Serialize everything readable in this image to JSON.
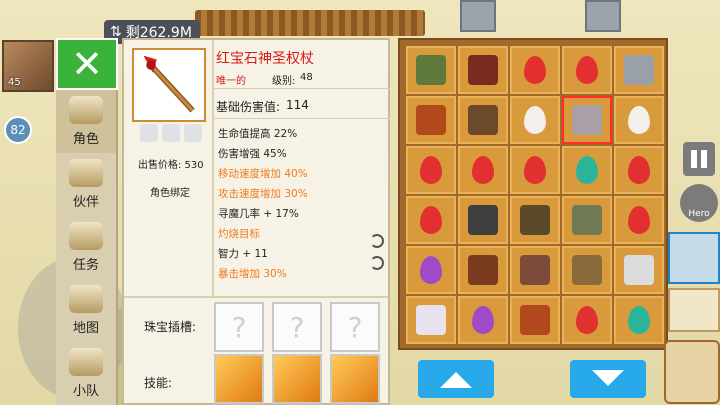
{
  "hud": {
    "data_remaining": "剩262.9M",
    "avatar_level": "45",
    "round_badge": "82",
    "hero_label": "Hero"
  },
  "menu": {
    "items": [
      {
        "label": "角色"
      },
      {
        "label": "伙伴"
      },
      {
        "label": "任务"
      },
      {
        "label": "地图"
      },
      {
        "label": "小队"
      }
    ]
  },
  "item": {
    "name": "红宝石神圣权杖",
    "rarity": "唯一的",
    "level_label": "级别:",
    "level_value": "48",
    "price": "出售价格: 530",
    "bound": "角色绑定",
    "base_damage_label": "基础伤害值:",
    "base_damage_value": "114",
    "stats": [
      {
        "text": "生命值提高 22%",
        "color": "black"
      },
      {
        "text": "伤害增强 45%",
        "color": "black"
      },
      {
        "text": "移动速度增加 40%",
        "color": "orange"
      },
      {
        "text": "攻击速度增加 30%",
        "color": "orange"
      },
      {
        "text": "寻魔几率 + 17%",
        "color": "black"
      },
      {
        "text": "灼烧目标",
        "color": "orange"
      },
      {
        "text": "智力 + 11",
        "color": "black"
      },
      {
        "text": "暴击增加 30%",
        "color": "orange"
      }
    ],
    "gem_slots_label": "珠宝插槽:",
    "skills_label": "技能:"
  },
  "colors": {
    "accent_green": "#39b33a",
    "accent_blue": "#28a9ea",
    "item_name_red": "#d61b1b",
    "stat_orange": "#f07a1e"
  },
  "inventory": {
    "cells": [
      {
        "kind": "gear",
        "color": "#5e7a3a"
      },
      {
        "kind": "gear",
        "color": "#7b2a22"
      },
      {
        "kind": "gem",
        "color": "#e23030"
      },
      {
        "kind": "gem",
        "color": "#e23030"
      },
      {
        "kind": "gear",
        "color": "#9aa0a8"
      },
      {
        "kind": "gear",
        "color": "#b2491c"
      },
      {
        "kind": "gear",
        "color": "#6a4a2a"
      },
      {
        "kind": "gem",
        "color": "#f3f0ec"
      },
      {
        "kind": "gear",
        "color": "#a8a0a6",
        "selected": true
      },
      {
        "kind": "gem",
        "color": "#f3f0ec"
      },
      {
        "kind": "gem",
        "color": "#e23030"
      },
      {
        "kind": "gem",
        "color": "#e23030"
      },
      {
        "kind": "gem",
        "color": "#e23030"
      },
      {
        "kind": "gem",
        "color": "#2ab59a"
      },
      {
        "kind": "gem",
        "color": "#e23030"
      },
      {
        "kind": "gem",
        "color": "#e23030"
      },
      {
        "kind": "gear",
        "color": "#3e3e3e"
      },
      {
        "kind": "gear",
        "color": "#5a4a2a"
      },
      {
        "kind": "gear",
        "color": "#6f7a55"
      },
      {
        "kind": "gem",
        "color": "#e23030"
      },
      {
        "kind": "gem",
        "color": "#a04ac8"
      },
      {
        "kind": "gear",
        "color": "#7a3b1e"
      },
      {
        "kind": "gear",
        "color": "#7e4a3a"
      },
      {
        "kind": "gear",
        "color": "#8a6a3a"
      },
      {
        "kind": "gear",
        "color": "#dcdcdc"
      },
      {
        "kind": "gear",
        "color": "#e7e2f0"
      },
      {
        "kind": "gem",
        "color": "#a04ac8"
      },
      {
        "kind": "gear",
        "color": "#b2491c"
      },
      {
        "kind": "gem",
        "color": "#e23030"
      },
      {
        "kind": "gem",
        "color": "#2ab59a"
      }
    ]
  }
}
